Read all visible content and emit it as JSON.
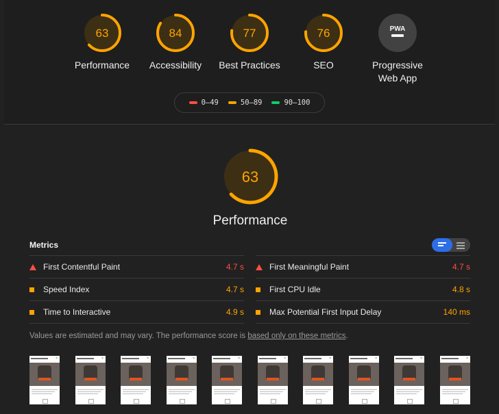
{
  "colors": {
    "fail": "#ff4e42",
    "average": "#ffa400",
    "pass": "#0cce6b",
    "average_bg": "#3d2f14",
    "pwa_bg": "#424242",
    "toggle_active": "#2d6ee8"
  },
  "categories": [
    {
      "key": "performance",
      "score": "63",
      "label": "Performance",
      "fraction": 0.63
    },
    {
      "key": "accessibility",
      "score": "84",
      "label": "Accessibility",
      "fraction": 0.84
    },
    {
      "key": "best-practices",
      "score": "77",
      "label": "Best Practices",
      "fraction": 0.77
    },
    {
      "key": "seo",
      "score": "76",
      "label": "SEO",
      "fraction": 0.76
    }
  ],
  "pwa": {
    "badge": "PWA",
    "label_line1": "Progressive",
    "label_line2": "Web App"
  },
  "legend": [
    {
      "range": "0–49",
      "color": "#ff4e42"
    },
    {
      "range": "50–89",
      "color": "#ffa400"
    },
    {
      "range": "90–100",
      "color": "#0cce6b"
    }
  ],
  "performance": {
    "score": "63",
    "title": "Performance",
    "fraction": 0.63
  },
  "metrics": {
    "title": "Metrics",
    "items": [
      {
        "name": "First Contentful Paint",
        "value": "4.7 s",
        "status": "fail"
      },
      {
        "name": "First Meaningful Paint",
        "value": "4.7 s",
        "status": "fail"
      },
      {
        "name": "Speed Index",
        "value": "4.7 s",
        "status": "average"
      },
      {
        "name": "First CPU Idle",
        "value": "4.8 s",
        "status": "average"
      },
      {
        "name": "Time to Interactive",
        "value": "4.9 s",
        "status": "average"
      },
      {
        "name": "Max Potential First Input Delay",
        "value": "140 ms",
        "status": "average"
      }
    ],
    "note_text": "Values are estimated and may vary. The performance score is ",
    "note_link": "based only on these metrics",
    "note_end": "."
  },
  "filmstrip": {
    "count": 10
  }
}
